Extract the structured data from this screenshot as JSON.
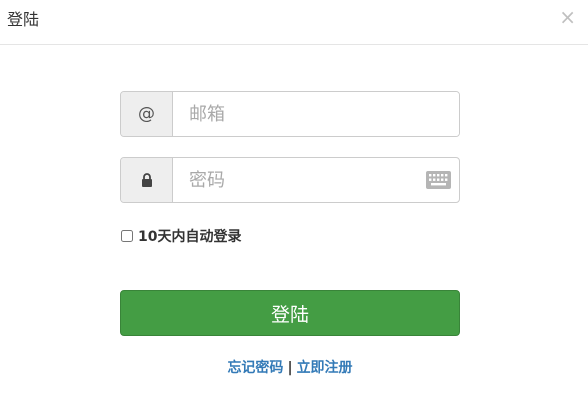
{
  "dialog": {
    "title": "登陆",
    "close_label": "×"
  },
  "form": {
    "email": {
      "addon_label": "@",
      "placeholder": "邮箱",
      "value": ""
    },
    "password": {
      "placeholder": "密码",
      "value": "",
      "addon_icon": "lock-icon",
      "keyboard_icon": "keyboard-icon"
    },
    "remember": {
      "label": "10天内自动登录",
      "checked": false
    },
    "submit_label": "登陆"
  },
  "links": {
    "forgot_password": "忘记密码",
    "separator": "|",
    "register": "立即注册"
  },
  "colors": {
    "primary_button": "#449d44",
    "link": "#337ab7",
    "addon_bg": "#eeeeee",
    "border": "#cccccc"
  }
}
